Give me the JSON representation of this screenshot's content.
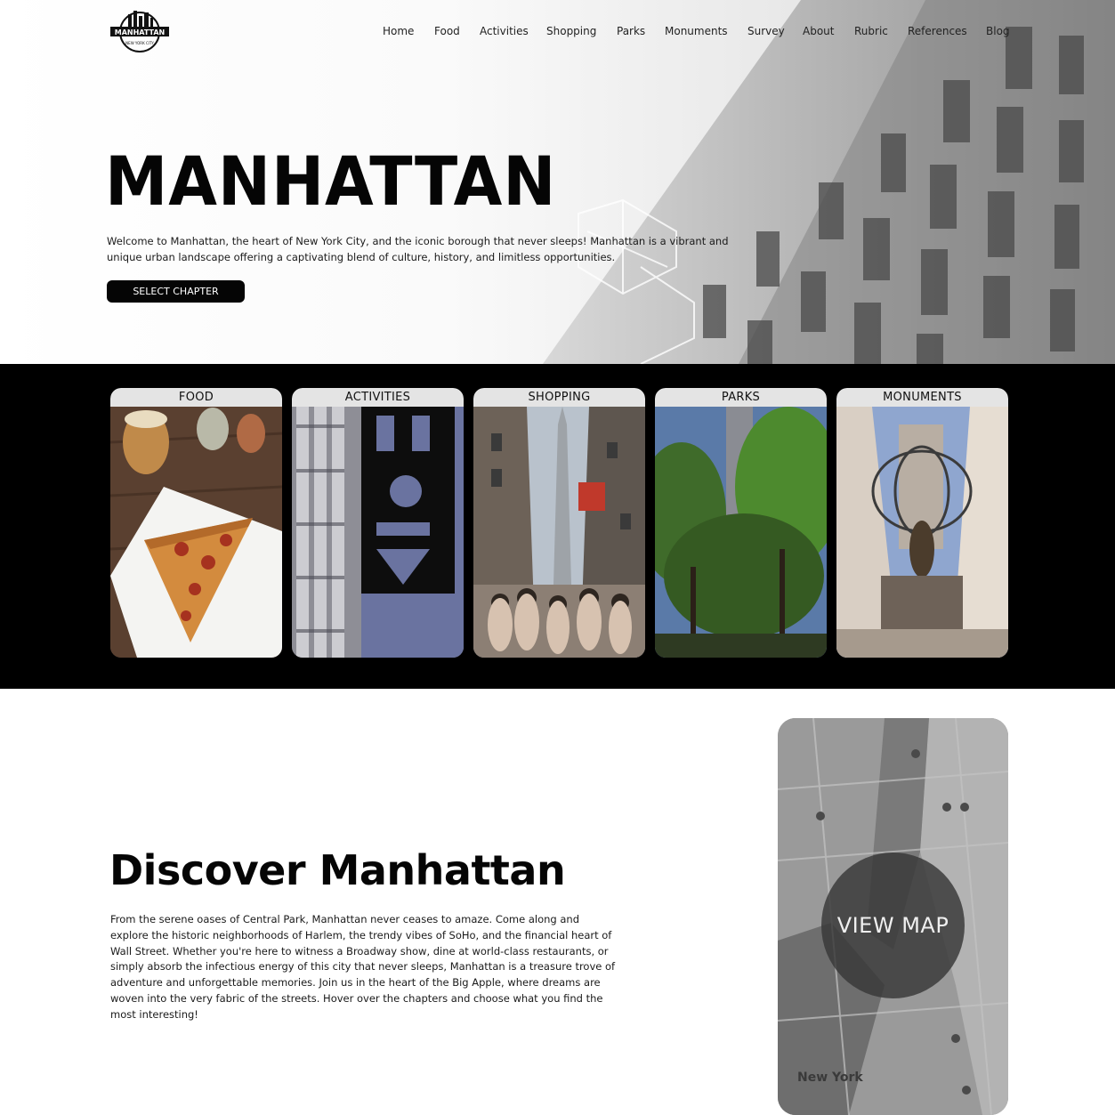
{
  "header": {
    "logo_text": "MANHATTAN",
    "logo_subtext": "NEW YORK CITY",
    "nav": [
      {
        "label": "Home"
      },
      {
        "label": "Food"
      },
      {
        "label": "Activities"
      },
      {
        "label": "Shopping"
      },
      {
        "label": "Parks"
      },
      {
        "label": "Monuments"
      },
      {
        "label": "Survey"
      },
      {
        "label": "About"
      },
      {
        "label": "Rubric"
      },
      {
        "label": "References"
      },
      {
        "label": "Blog"
      }
    ]
  },
  "hero": {
    "title": "MANHATTAN",
    "description": "Welcome to Manhattan, the heart of New York City, and the iconic borough that never sleeps! Manhattan is a vibrant and unique urban landscape offering a captivating blend of culture, history, and limitless opportunities.",
    "button_label": "SELECT CHAPTER"
  },
  "chapters": [
    {
      "label": "FOOD"
    },
    {
      "label": "ACTIVITIES"
    },
    {
      "label": "SHOPPING"
    },
    {
      "label": "PARKS"
    },
    {
      "label": "MONUMENTS"
    }
  ],
  "discover": {
    "title": "Discover Manhattan",
    "text": "From the serene oases of Central Park, Manhattan never ceases to amaze. Come along and explore the historic neighborhoods of Harlem, the trendy vibes of SoHo, and the financial heart of Wall Street. Whether you're here to witness a Broadway show, dine at world-class restaurants, or simply absorb the infectious energy of this city that never sleeps, Manhattan is a treasure trove of adventure and unforgettable memories. Join us in the heart of the Big Apple, where dreams are woven into the very fabric of the streets. Hover over the chapters and choose what you find the most interesting!"
  },
  "map": {
    "button_label": "VIEW MAP",
    "city_label": "New York"
  },
  "colors": {
    "black": "#000000",
    "card_label_bg": "#e4e4e4",
    "button_bg": "#050505"
  }
}
